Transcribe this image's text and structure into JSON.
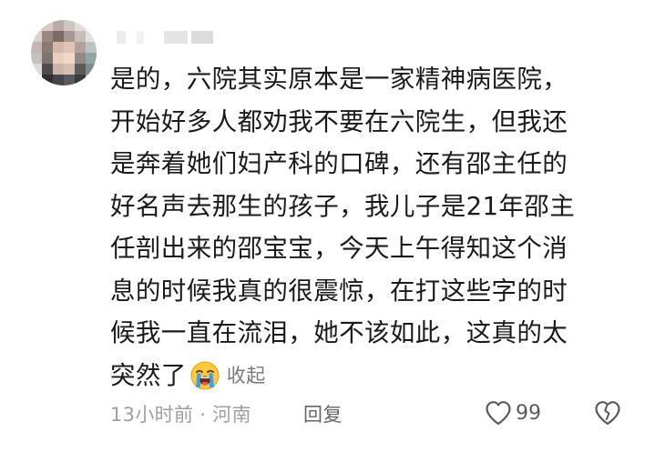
{
  "comment": {
    "lines": [
      "是的，六院其实原本是一家精神病医院，",
      "开始好多人都劝我不要在六院生，但我还",
      "是奔着她们妇产科的口碑，还有邵主任的",
      "好名声去那生的孩子，我儿子是21年邵主",
      "任剖出来的邵宝宝，今天上午得知这个消",
      "息的时候我真的很震惊，在打这些字的时",
      "候我一直在流泪，她不该如此，这真的太"
    ],
    "last_line": "突然了",
    "emoji": "loudly-crying-face",
    "collapse_label": "收起"
  },
  "footer": {
    "meta": "13小时前 · 河南",
    "reply_label": "回复",
    "like_count": "99"
  },
  "colors": {
    "text": "#1a1a1a",
    "meta": "#a0a0a0",
    "secondary": "#666666",
    "emoji_face": "#ffc83d",
    "emoji_tears": "#3aa0e8"
  }
}
